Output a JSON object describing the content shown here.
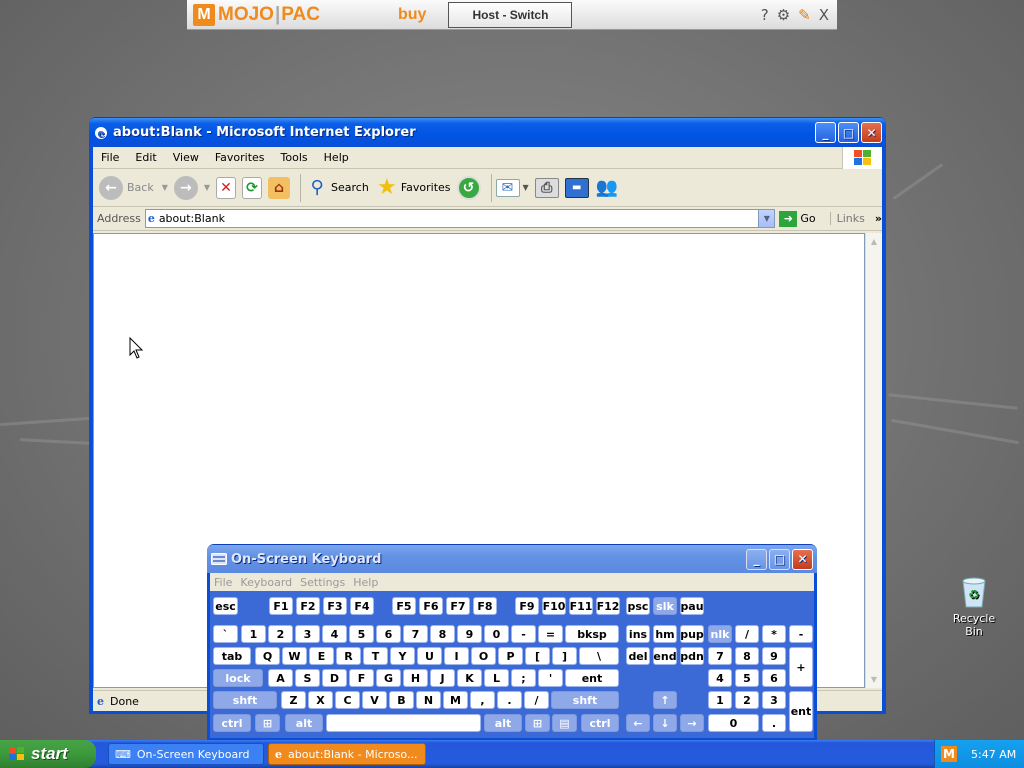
{
  "mojopac": {
    "logo_left": "MOJO",
    "logo_right": "PAC",
    "buy": "buy",
    "switch": "Host - Switch",
    "help": "?",
    "close": "X"
  },
  "ie": {
    "title": "about:Blank - Microsoft Internet Explorer",
    "menu": [
      "File",
      "Edit",
      "View",
      "Favorites",
      "Tools",
      "Help"
    ],
    "toolbar": {
      "back": "Back",
      "search": "Search",
      "favorites": "Favorites"
    },
    "address_label": "Address",
    "address_value": "about:Blank",
    "go": "Go",
    "links": "Links",
    "status": "Done"
  },
  "osk": {
    "title": "On-Screen Keyboard",
    "menu": [
      "File",
      "Keyboard",
      "Settings",
      "Help"
    ]
  },
  "desktop": {
    "recycle_bin": "Recycle Bin"
  },
  "taskbar": {
    "start": "start",
    "tasks": [
      "On-Screen Keyboard",
      "about:Blank - Microso..."
    ],
    "clock": "5:47 AM"
  },
  "keyboard_rows": [
    [
      [
        "esc",
        3,
        25
      ],
      [
        "F1",
        59,
        24
      ],
      [
        "F2",
        86,
        24
      ],
      [
        "F3",
        113,
        24
      ],
      [
        "F4",
        140,
        24
      ],
      [
        "F5",
        182,
        24
      ],
      [
        "F6",
        209,
        24
      ],
      [
        "F7",
        236,
        24
      ],
      [
        "F8",
        263,
        24
      ],
      [
        "F9",
        305,
        24
      ],
      [
        "F10",
        332,
        24
      ],
      [
        "F11",
        359,
        24
      ],
      [
        "F12",
        386,
        24
      ],
      [
        "psc",
        416,
        24
      ],
      [
        "slk",
        443,
        24,
        "dim"
      ],
      [
        "pau",
        470,
        24
      ]
    ],
    [
      [
        "`",
        3,
        25
      ],
      [
        "1",
        31,
        25
      ],
      [
        "2",
        58,
        25
      ],
      [
        "3",
        85,
        25
      ],
      [
        "4",
        112,
        25
      ],
      [
        "5",
        139,
        25
      ],
      [
        "6",
        166,
        25
      ],
      [
        "7",
        193,
        25
      ],
      [
        "8",
        220,
        25
      ],
      [
        "9",
        247,
        25
      ],
      [
        "0",
        274,
        25
      ],
      [
        "-",
        301,
        25
      ],
      [
        "=",
        328,
        25
      ],
      [
        "bksp",
        355,
        54
      ],
      [
        "ins",
        416,
        24
      ],
      [
        "hm",
        443,
        24
      ],
      [
        "pup",
        470,
        24
      ],
      [
        "nlk",
        498,
        24,
        "dim"
      ],
      [
        "/",
        525,
        24
      ],
      [
        "*",
        552,
        24
      ],
      [
        "-",
        579,
        24
      ]
    ],
    [
      [
        "tab",
        3,
        38
      ],
      [
        "Q",
        45,
        25
      ],
      [
        "W",
        72,
        25
      ],
      [
        "E",
        99,
        25
      ],
      [
        "R",
        126,
        25
      ],
      [
        "T",
        153,
        25
      ],
      [
        "Y",
        180,
        25
      ],
      [
        "U",
        207,
        25
      ],
      [
        "I",
        234,
        25
      ],
      [
        "O",
        261,
        25
      ],
      [
        "P",
        288,
        25
      ],
      [
        "[",
        315,
        25
      ],
      [
        "]",
        342,
        25
      ],
      [
        "\\",
        369,
        40
      ],
      [
        "del",
        416,
        24
      ],
      [
        "end",
        443,
        24
      ],
      [
        "pdn",
        470,
        24
      ],
      [
        "7",
        498,
        24
      ],
      [
        "8",
        525,
        24
      ],
      [
        "9",
        552,
        24
      ]
    ],
    [
      [
        "lock",
        3,
        50,
        "dim"
      ],
      [
        "A",
        58,
        25
      ],
      [
        "S",
        85,
        25
      ],
      [
        "D",
        112,
        25
      ],
      [
        "F",
        139,
        25
      ],
      [
        "G",
        166,
        25
      ],
      [
        "H",
        193,
        25
      ],
      [
        "J",
        220,
        25
      ],
      [
        "K",
        247,
        25
      ],
      [
        "L",
        274,
        25
      ],
      [
        ";",
        301,
        25
      ],
      [
        "'",
        328,
        25
      ],
      [
        "ent",
        355,
        54
      ],
      [
        "4",
        498,
        24
      ],
      [
        "5",
        525,
        24
      ],
      [
        "6",
        552,
        24
      ]
    ],
    [
      [
        "shft",
        3,
        64,
        "dim"
      ],
      [
        "Z",
        71,
        25
      ],
      [
        "X",
        98,
        25
      ],
      [
        "C",
        125,
        25
      ],
      [
        "V",
        152,
        25
      ],
      [
        "B",
        179,
        25
      ],
      [
        "N",
        206,
        25
      ],
      [
        "M",
        233,
        25
      ],
      [
        ",",
        260,
        25
      ],
      [
        ".",
        287,
        25
      ],
      [
        "/",
        314,
        25
      ],
      [
        "shft",
        341,
        68,
        "dim"
      ],
      [
        "↑",
        443,
        24,
        "dim"
      ],
      [
        "1",
        498,
        24
      ],
      [
        "2",
        525,
        24
      ],
      [
        "3",
        552,
        24
      ]
    ],
    [
      [
        "ctrl",
        3,
        38,
        "dim"
      ],
      [
        "⊞",
        45,
        25,
        "dim"
      ],
      [
        "alt",
        75,
        38,
        "dim"
      ],
      [
        " ",
        116,
        155
      ],
      [
        "alt",
        274,
        38,
        "dim"
      ],
      [
        "⊞",
        315,
        25,
        "dim"
      ],
      [
        "▤",
        342,
        25,
        "dim"
      ],
      [
        "ctrl",
        371,
        38,
        "dim"
      ],
      [
        "←",
        416,
        24,
        "dim"
      ],
      [
        "↓",
        443,
        24,
        "dim"
      ],
      [
        "→",
        470,
        24,
        "dim"
      ],
      [
        "0",
        498,
        51
      ],
      [
        ".",
        552,
        24
      ]
    ]
  ],
  "keyboard_tall": [
    [
      "+",
      579,
      "plus"
    ],
    [
      "ent",
      579,
      "enter"
    ]
  ]
}
